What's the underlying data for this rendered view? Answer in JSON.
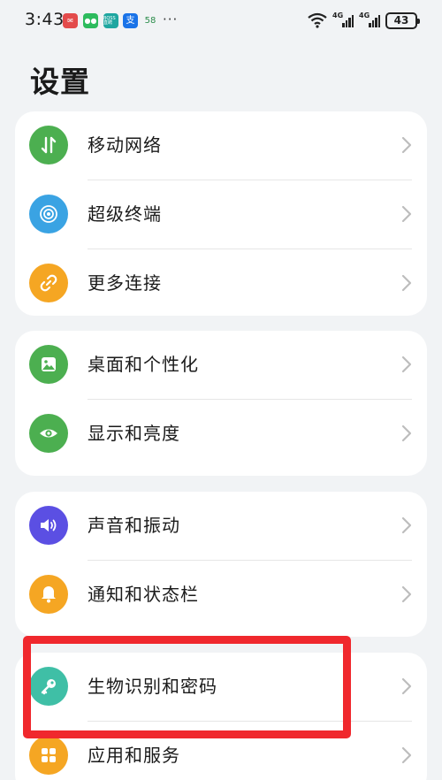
{
  "status_bar": {
    "time": "3:43",
    "notifications": [
      "app-red",
      "wechat",
      "boss",
      "alipay",
      "58"
    ],
    "notification_texts": {
      "boss": "BOSS直聘",
      "alipay": "支",
      "n58": "58"
    },
    "more": "···",
    "network_1": "4G",
    "network_2": "4G",
    "battery": "43"
  },
  "page_title": "设置",
  "groups": [
    {
      "items": [
        {
          "label": "移动网络",
          "icon": "mobile-data-icon",
          "color": "#4caf50"
        },
        {
          "label": "超级终端",
          "icon": "super-device-icon",
          "color": "#3aa3e3"
        },
        {
          "label": "更多连接",
          "icon": "link-icon",
          "color": "#f5a623"
        }
      ]
    },
    {
      "items": [
        {
          "label": "桌面和个性化",
          "icon": "wallpaper-icon",
          "color": "#4caf50"
        },
        {
          "label": "显示和亮度",
          "icon": "eye-icon",
          "color": "#4caf50"
        }
      ]
    },
    {
      "items": [
        {
          "label": "声音和振动",
          "icon": "speaker-icon",
          "color": "#5b4fe3"
        },
        {
          "label": "通知和状态栏",
          "icon": "bell-icon",
          "color": "#f5a623"
        }
      ]
    },
    {
      "items": [
        {
          "label": "生物识别和密码",
          "icon": "key-icon",
          "color": "#3fbfa6"
        },
        {
          "label": "应用和服务",
          "icon": "apps-icon",
          "color": "#f5a623"
        }
      ]
    }
  ],
  "annotation": {
    "color": "#f0282d",
    "target": "生物识别和密码"
  }
}
